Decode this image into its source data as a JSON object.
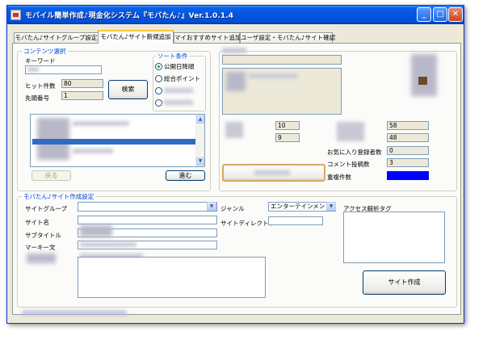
{
  "window": {
    "title": "モバイル簡単作成♪現金化システム『モバたん♪』Ver.1.0.1.4",
    "minimize": "_",
    "maximize": "□",
    "close": "✕"
  },
  "tabs": [
    {
      "label": "モバたん♪サイトグループ設定"
    },
    {
      "label": "モバたん♪サイト新規追加"
    },
    {
      "label": "マイおすすめサイト追加"
    },
    {
      "label": "ユーザ設定・モバたん♪サイト確認"
    }
  ],
  "content_select": {
    "title": "コンテンツ選択",
    "keyword_label": "キーワード",
    "keyword_value": "",
    "hits_label": "ヒット件数",
    "hits_value": "80",
    "start_label": "先頭番号",
    "start_value": "1",
    "search_button": "検索",
    "back_button": "戻る",
    "next_button": "進む"
  },
  "sort": {
    "title": "ソート条件",
    "options": [
      {
        "label": "公開日降順",
        "selected": true
      },
      {
        "label": "総合ポイント",
        "selected": false
      },
      {
        "label": "",
        "selected": false
      },
      {
        "label": "",
        "selected": false
      }
    ]
  },
  "detail": {
    "stat_a": "10",
    "stat_b": "9",
    "stat_c": "58",
    "stat_d": "48",
    "favorites_label": "お気に入り登録者数",
    "favorites_value": "0",
    "comments_label": "コメント投稿数",
    "comments_value": "3",
    "duplicates_label": "重複件数",
    "duplicate_color": "#0000ff"
  },
  "site_create": {
    "title": "モバたん♪サイト作成設定",
    "group_label": "サイトグループ",
    "group_value": "",
    "name_label": "サイト名",
    "subtitle_label": "サブタイトル",
    "marquee_label": "マーキー文",
    "genre_label": "ジャンル",
    "genre_value": "エンターテインメント",
    "dir_label": "サイトディレクトリ",
    "analytics_label": "アクセス解析タグ",
    "create_button": "サイト作成"
  }
}
